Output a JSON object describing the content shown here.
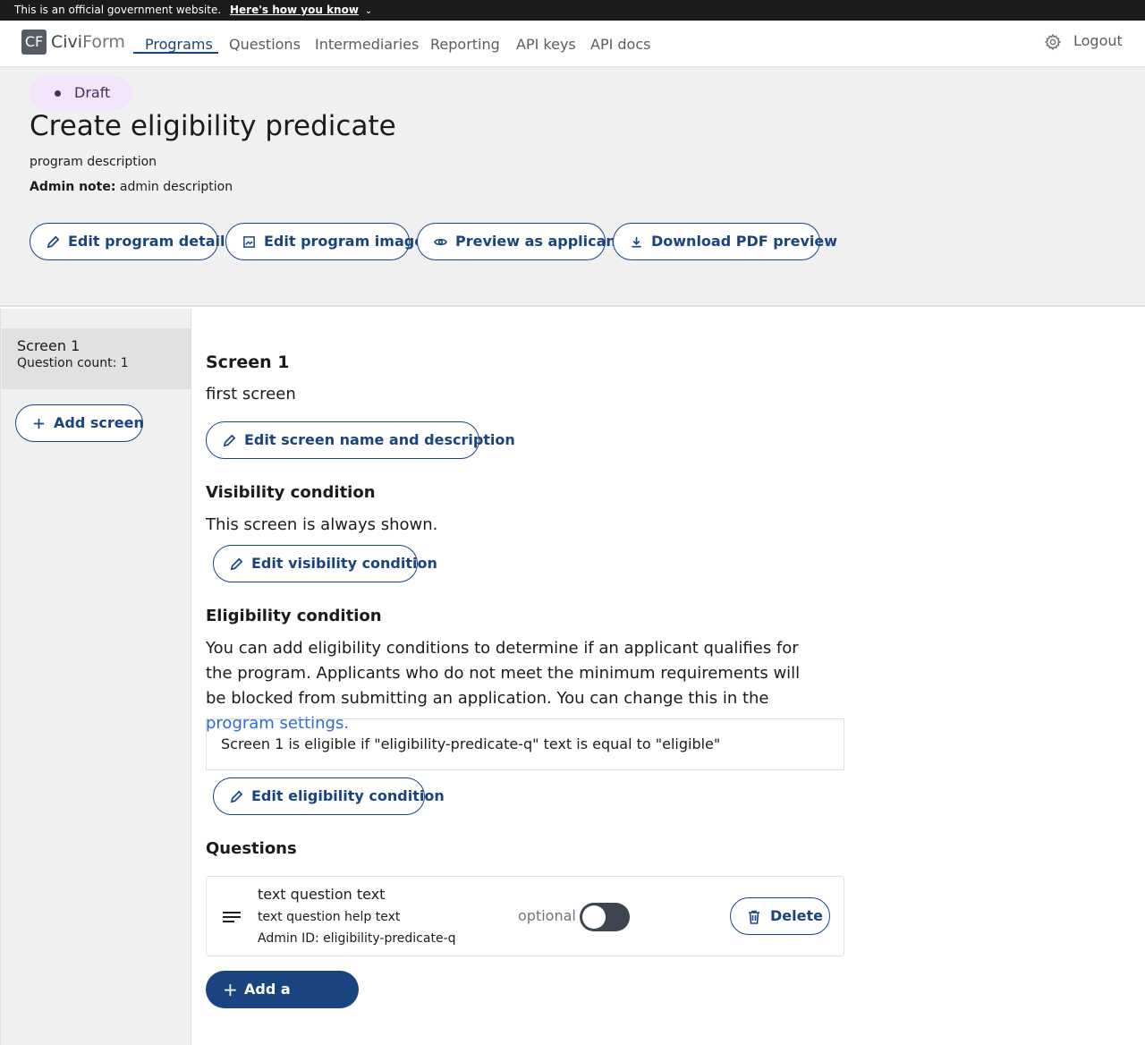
{
  "gov_banner": {
    "text": "This is an official government website.",
    "link": "Here's how you know"
  },
  "nav": {
    "logo_mark": "CF",
    "logo_civi": "Civi",
    "logo_form": "Form",
    "links": [
      "Programs",
      "Questions",
      "Intermediaries",
      "Reporting",
      "API keys",
      "API docs"
    ],
    "active": "Programs",
    "logout": "Logout"
  },
  "header": {
    "status": "Draft",
    "title": "Create eligibility predicate",
    "description": "program description",
    "admin_note_label": "Admin note:",
    "admin_note": "admin description",
    "buttons": [
      "Edit program details",
      "Edit program image",
      "Preview as applicant",
      "Download PDF preview"
    ]
  },
  "sidebar": {
    "screens": [
      {
        "name": "Screen 1",
        "question_count": "Question count: 1"
      }
    ],
    "add_screen": "Add screen"
  },
  "main": {
    "screen_title": "Screen 1",
    "screen_description": "first screen",
    "edit_screen_button": "Edit screen name and description",
    "visibility_heading": "Visibility condition",
    "visibility_text": "This screen is always shown.",
    "edit_visibility_button": "Edit visibility condition",
    "eligibility_heading": "Eligibility condition",
    "eligibility_text": "You can add eligibility conditions to determine if an applicant qualifies for the program. Applicants who do not meet the minimum requirements will be blocked from submitting an application. You can change this in the",
    "eligibility_link": "program settings.",
    "predicate": "Screen 1 is eligible if \"eligibility-predicate-q\" text is equal to \"eligible\"",
    "edit_eligibility_button": "Edit eligibility condition",
    "questions_heading": "Questions",
    "question": {
      "text": "text question text",
      "help": "text question help text",
      "admin_id": "Admin ID: eligibility-predicate-q",
      "optional_label": "optional",
      "optional_on": false,
      "delete": "Delete"
    },
    "add_question": "Add a question"
  }
}
